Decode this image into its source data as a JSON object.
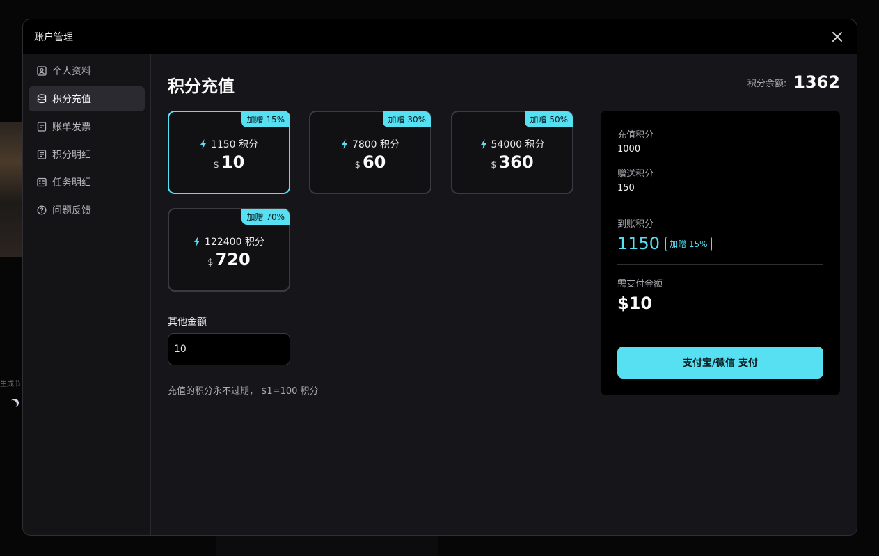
{
  "modal": {
    "title": "账户管理"
  },
  "sidebar": {
    "items": [
      {
        "label": "个人资料",
        "icon": "user-card-icon"
      },
      {
        "label": "积分充值",
        "icon": "database-icon"
      },
      {
        "label": "账单发票",
        "icon": "receipt-icon"
      },
      {
        "label": "积分明细",
        "icon": "document-list-icon"
      },
      {
        "label": "任务明细",
        "icon": "task-list-icon"
      },
      {
        "label": "问题反馈",
        "icon": "help-circle-icon"
      }
    ],
    "active_index": 1
  },
  "main": {
    "title": "积分充值",
    "balance_label": "积分余额:",
    "balance_value": "1362",
    "packages": [
      {
        "badge": "加赠 15%",
        "points": "1150 积分",
        "currency": "$",
        "amount": "10",
        "selected": true
      },
      {
        "badge": "加赠 30%",
        "points": "7800 积分",
        "currency": "$",
        "amount": "60",
        "selected": false
      },
      {
        "badge": "加赠 50%",
        "points": "54000 积分",
        "currency": "$",
        "amount": "360",
        "selected": false
      },
      {
        "badge": "加赠 70%",
        "points": "122400 积分",
        "currency": "$",
        "amount": "720",
        "selected": false
      }
    ],
    "other_label": "其他金额",
    "other_value": "10",
    "note": "充值的积分永不过期， $1=100 积分"
  },
  "summary": {
    "recharge_label": "充值积分",
    "recharge_value": "1000",
    "bonus_label": "赠送积分",
    "bonus_value": "150",
    "arrived_label": "到账积分",
    "arrived_value": "1150",
    "arrived_badge": "加赠 15%",
    "pay_label": "需支付金额",
    "pay_value": "$10",
    "pay_button": "支付宝/微信 支付"
  },
  "background": {
    "fragment_text": "生成节"
  },
  "colors": {
    "accent": "#57dff2",
    "panel": "#16161a",
    "header": "#000000"
  }
}
